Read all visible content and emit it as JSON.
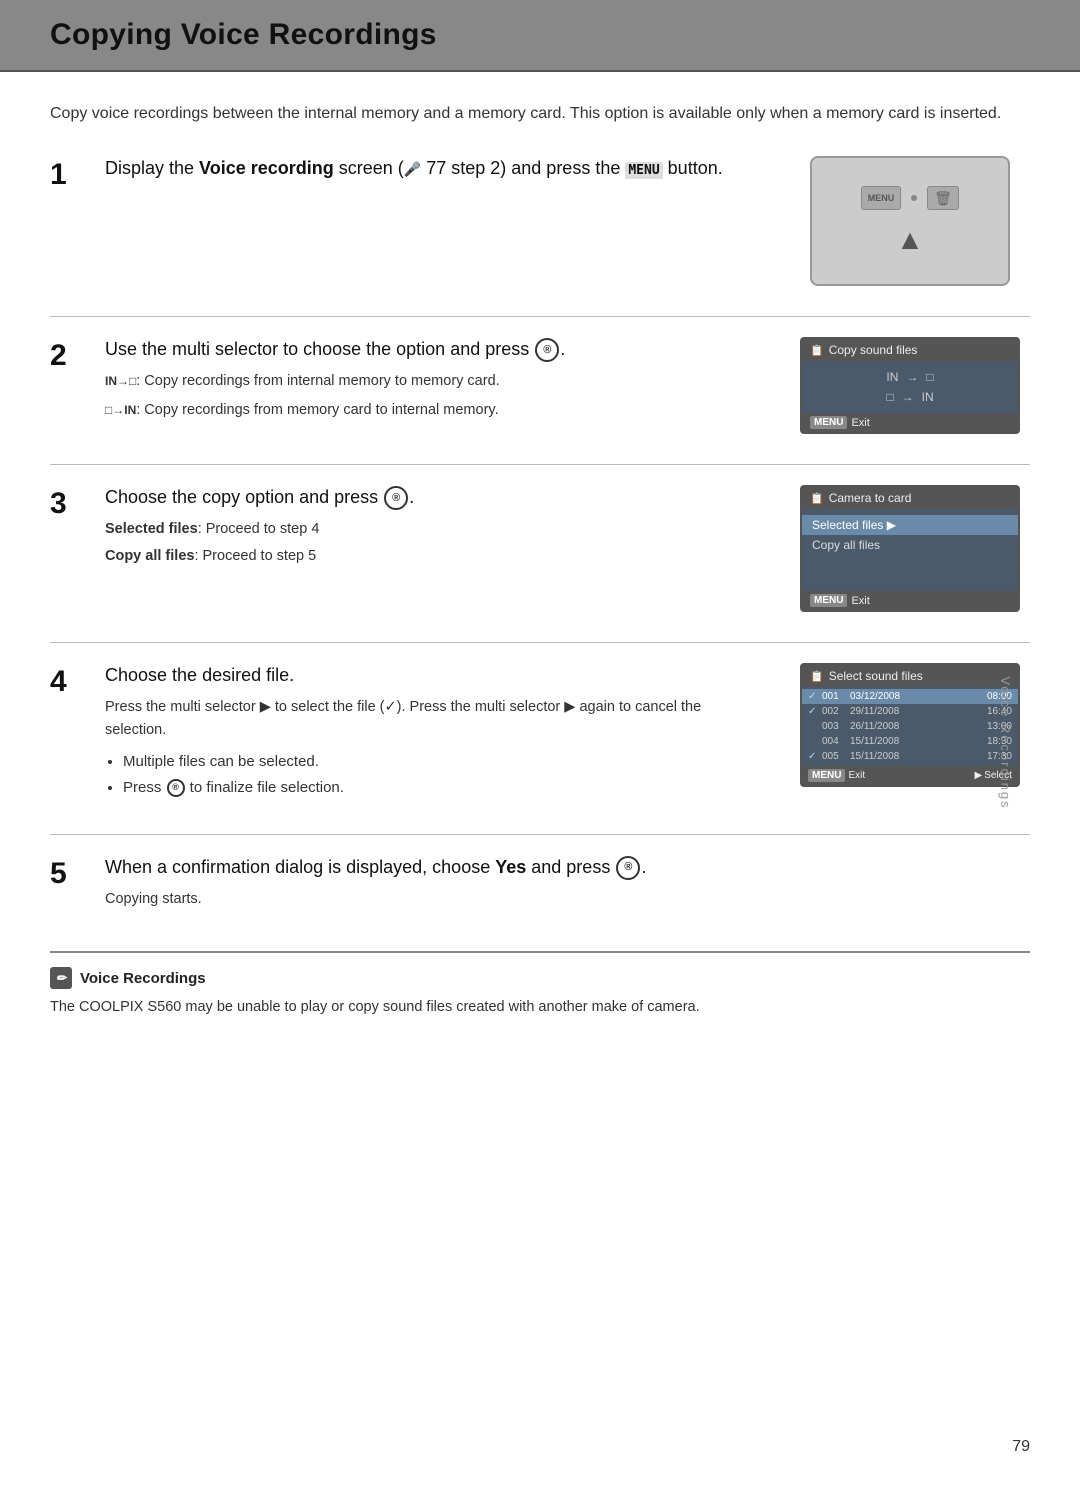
{
  "page": {
    "title": "Copying Voice Recordings",
    "intro": "Copy voice recordings between the internal memory and a memory card. This option is available only when a memory card is inserted.",
    "page_number": "79",
    "side_label": "Voice Recordings"
  },
  "steps": [
    {
      "number": "1",
      "title_parts": [
        "Display the ",
        "Voice recording",
        " screen (",
        "77",
        " step 2) and press the ",
        "MENU",
        " button."
      ],
      "has_image": "camera"
    },
    {
      "number": "2",
      "title": "Use the multi selector to choose the option and press",
      "has_ok": true,
      "sub1_icon": "IN→SD",
      "sub1_text": "Copy recordings from internal memory to memory card.",
      "sub2_icon": "SD→IN",
      "sub2_text": "Copy recordings from memory card to internal memory.",
      "screen_title": "Copy sound files"
    },
    {
      "number": "3",
      "title": "Choose the copy option and press",
      "has_ok": true,
      "bold_items": [
        {
          "label": "Selected files",
          "text": ": Proceed to step 4"
        },
        {
          "label": "Copy all files",
          "text": ": Proceed to step 5"
        }
      ],
      "screen_title": "Camera to card",
      "screen_items": [
        "Selected files",
        "Copy all files"
      ]
    },
    {
      "number": "4",
      "title": "Choose the desired file.",
      "body_text": "Press the multi selector ▶ to select the file (✓). Press the multi selector ▶ again to cancel the selection.",
      "bullets": [
        "Multiple files can be selected.",
        "Press ® to finalize file selection."
      ],
      "screen_title": "Select sound files",
      "files": [
        {
          "check": "✓",
          "num": "001",
          "date": "03/12/2008",
          "time": "08:00",
          "selected": true
        },
        {
          "check": "✓",
          "num": "002",
          "date": "29/11/2008",
          "time": "16:40",
          "selected": false
        },
        {
          "check": "",
          "num": "003",
          "date": "26/11/2008",
          "time": "13:00",
          "selected": false
        },
        {
          "check": "",
          "num": "004",
          "date": "15/11/2008",
          "time": "18:30",
          "selected": false
        },
        {
          "check": "✓",
          "num": "005",
          "date": "15/11/2008",
          "time": "17:30",
          "selected": false
        }
      ]
    },
    {
      "number": "5",
      "title_pre": "When a confirmation dialog is displayed, choose ",
      "title_bold": "Yes",
      "title_post": " and press",
      "has_ok": true,
      "sub_text": "Copying starts."
    }
  ],
  "note": {
    "title": "Voice Recordings",
    "text": "The COOLPIX S560 may be unable to play or copy sound files created with another make of camera."
  }
}
